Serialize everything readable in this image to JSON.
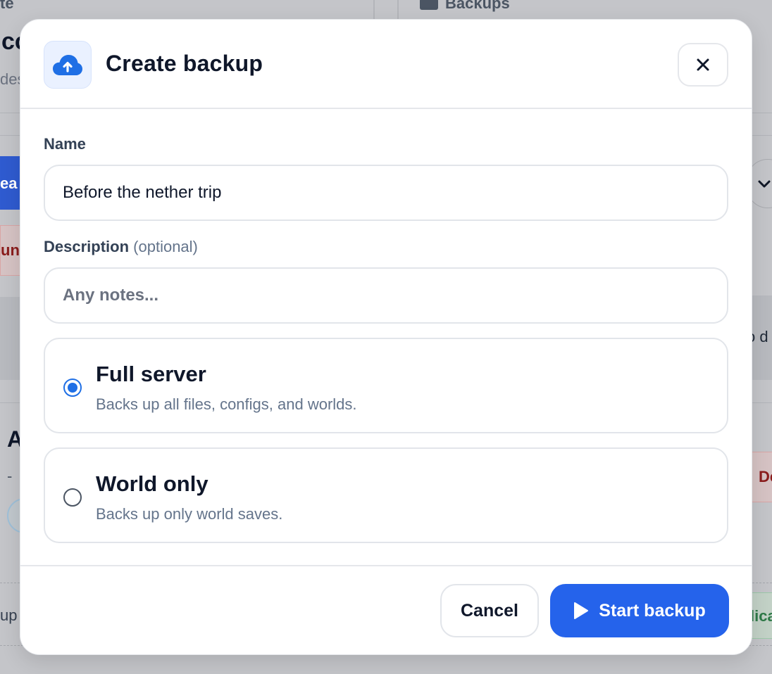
{
  "background": {
    "left_heading_fragment": "te",
    "left_title_fragment": "cc",
    "left_subtitle_fragment": "des",
    "right_heading": "Backups",
    "blue_button_fragment": "ea",
    "red_tag_fragment": "une",
    "row_title_fragment": "A",
    "row_dash": "-",
    "footer_fragment": "up",
    "right_text_fragment": "o d",
    "right_red_fragment": "De",
    "right_green_fragment": "lica"
  },
  "modal": {
    "title": "Create backup",
    "icon": "cloud-upload-icon",
    "close_icon": "close-icon",
    "accent_color": "#2563eb",
    "name_field": {
      "label": "Name",
      "value": "Before the nether trip"
    },
    "description_field": {
      "label": "Description",
      "optional_label": "(optional)",
      "value": "",
      "placeholder": "Any notes..."
    },
    "options": [
      {
        "title": "Full server",
        "description": "Backs up all files, configs, and worlds.",
        "selected": true
      },
      {
        "title": "World only",
        "description": "Backs up only world saves.",
        "selected": false
      }
    ],
    "actions": {
      "cancel_label": "Cancel",
      "start_label": "Start backup",
      "start_icon": "play-icon"
    }
  }
}
